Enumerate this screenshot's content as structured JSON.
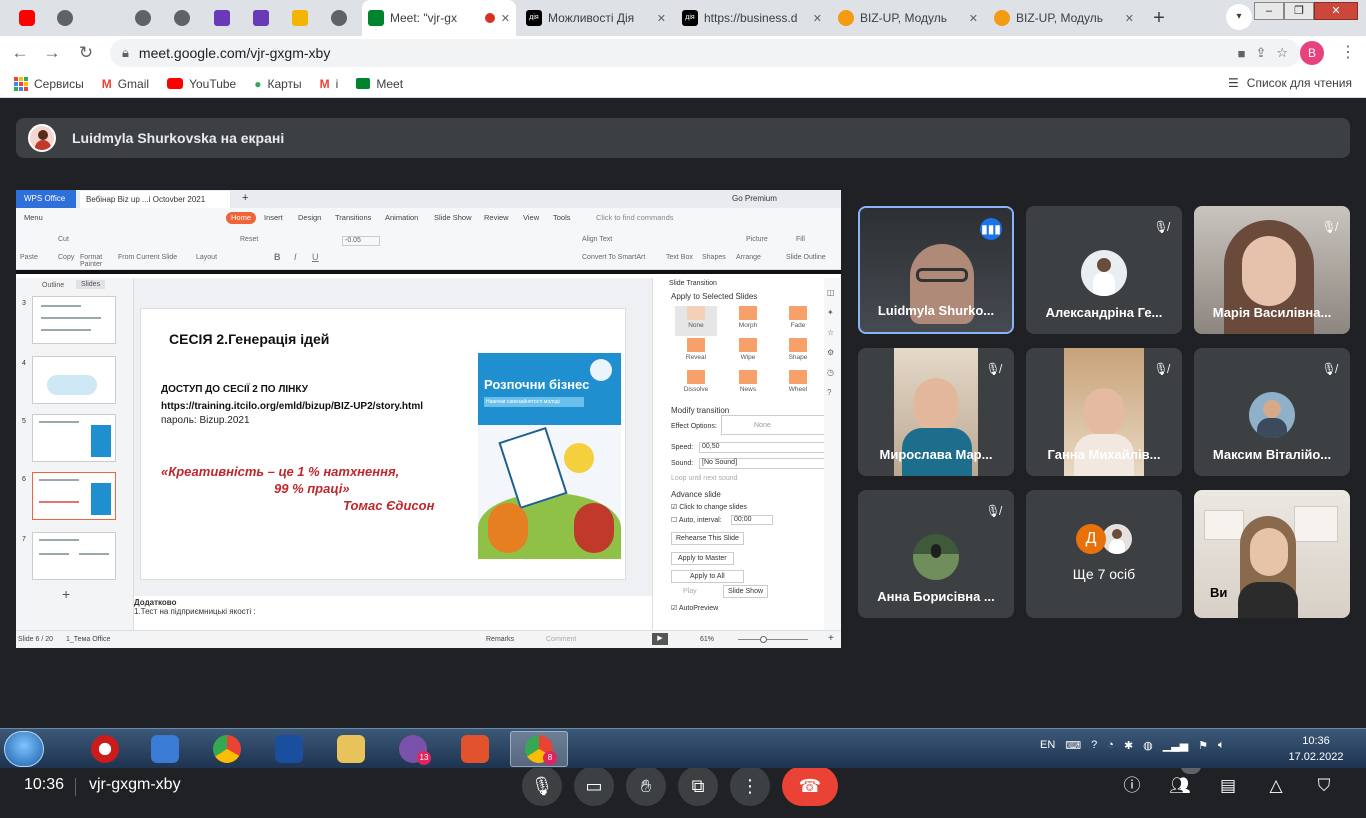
{
  "browser": {
    "tabs": [
      {
        "title": "",
        "icon": "youtube-icon",
        "color": "#ff0000"
      },
      {
        "title": "",
        "icon": "globe-icon",
        "color": "#5f6368"
      },
      {
        "title": "",
        "icon": "globe-icon",
        "color": "#5f6368"
      },
      {
        "title": "",
        "icon": "globe-icon",
        "color": "#5f6368"
      },
      {
        "title": "",
        "icon": "forms-icon",
        "color": "#673ab7"
      },
      {
        "title": "",
        "icon": "forms-icon",
        "color": "#673ab7"
      },
      {
        "title": "",
        "icon": "slides-icon",
        "color": "#f4b400"
      },
      {
        "title": "",
        "icon": "globe-icon",
        "color": "#5f6368"
      },
      {
        "title": "Meet: \"vjr-gx",
        "icon": "meet-icon",
        "color": "#00832d",
        "active": true
      },
      {
        "title": "Можливості Дія",
        "icon": "diia-icon",
        "color": "#000000"
      },
      {
        "title": "https://business.d",
        "icon": "diia-icon",
        "color": "#000000"
      },
      {
        "title": "BIZ-UP, Модуль",
        "icon": "bizup-icon",
        "color": "#f39c12"
      },
      {
        "title": "BIZ-UP, Модуль",
        "icon": "bizup-icon",
        "color": "#f39c12"
      }
    ],
    "url": "meet.google.com/vjr-gxgm-xby",
    "profile_initial": "B",
    "bookmarks": [
      {
        "label": "Сервисы",
        "icon": "apps-grid-icon"
      },
      {
        "label": "Gmail",
        "icon": "gmail-icon"
      },
      {
        "label": "YouTube",
        "icon": "youtube-icon"
      },
      {
        "label": "Карты",
        "icon": "maps-icon"
      },
      {
        "label": "i",
        "icon": "gmail-icon"
      },
      {
        "label": "Meet",
        "icon": "meet-icon"
      }
    ],
    "reading_list": "Список для чтения"
  },
  "meet": {
    "presenter_banner": "Luidmyla Shurkovska на екрані",
    "time": "10:36",
    "meeting_code": "vjr-gxgm-xby",
    "participant_count": "16",
    "participants": [
      {
        "name": "Luidmyla Shurko...",
        "mic": "speaking",
        "video": true
      },
      {
        "name": "Александріна Ге...",
        "mic": "muted",
        "video": false
      },
      {
        "name": "Марія Василівна...",
        "mic": "muted",
        "video": true
      },
      {
        "name": "Мирослава Мар...",
        "mic": "muted",
        "video": true
      },
      {
        "name": "Ганна Михайлів...",
        "mic": "muted",
        "video": true
      },
      {
        "name": "Максим Віталійо...",
        "mic": "muted",
        "video": false
      },
      {
        "name": "Анна Борисівна ...",
        "mic": "muted",
        "video": false
      },
      {
        "name": "Ще 7 осіб",
        "initial": "Д"
      },
      {
        "name": "Ви",
        "video": true
      }
    ]
  },
  "wps": {
    "app_tab": "WPS Office",
    "doc_tab": "Вебінар Biz up ...i Octovber 2021",
    "premium": "Go Premium",
    "menu": [
      "Menu",
      "Home",
      "Insert",
      "Design",
      "Transitions",
      "Animation",
      "Slide Show",
      "Review",
      "View",
      "Tools",
      "Click to find commands"
    ],
    "ribbon": [
      "Paste",
      "Cut",
      "Copy",
      "Format Painter",
      "From Current Slide",
      "Layout",
      "Reset",
      "-0.05",
      "Align Text",
      "Convert To SmartArt",
      "Text Box",
      "Shapes",
      "Picture",
      "Arrange",
      "Fill",
      "Slide Outline"
    ],
    "left_tabs": [
      "Outline",
      "Slides"
    ],
    "slide_numbers": [
      "3",
      "4",
      "5",
      "6",
      "7"
    ],
    "slide": {
      "title": "СЕСІЯ 2.Генерація ідей",
      "access_line": "ДОСТУП ДО СЕСІЇ 2 ПО ЛІНКУ",
      "link": "https://training.itcilo.org/emld/bizup/BIZ-UP2/story.html",
      "password": "пароль: Bizup.2021",
      "quote_1": "«Креативність – це 1 % натхнення,",
      "quote_2": "99 % праці»",
      "quote_3": "Томас Єдисон",
      "book_title": "Розпочни бізнес",
      "book_subtitle": "Навички самозайнятості молоді"
    },
    "notes_heading": "Додатково",
    "notes_line": "1.Тест на підприємницькі якості :",
    "transition_panel": {
      "header": "Slide Transition",
      "apply_label": "Apply to Selected Slides",
      "effects": [
        "None",
        "Morph",
        "Fade",
        "Reveal",
        "Wipe",
        "Shape",
        "Dissolve",
        "News",
        "Wheel"
      ],
      "modify": "Modify transition",
      "effect_options_label": "Effect Options:",
      "effect_options_value": "None",
      "speed_label": "Speed:",
      "speed_value": "00,50",
      "sound_label": "Sound:",
      "sound_value": "[No Sound]",
      "loop": "Loop until next sound",
      "advance": "Advance slide",
      "click_change": "Click to change slides",
      "auto_interval": "Auto, interval:",
      "interval_value": "00:00",
      "rehearse": "Rehearse This Slide",
      "apply_master": "Apply to Master",
      "apply_all": "Apply to All",
      "play": "Play",
      "slide_show": "Slide Show",
      "autopreview": "AutoPreview"
    },
    "status": {
      "slide_info": "Slide 6 / 20",
      "theme": "1_Тема Office",
      "remarks": "Remarks",
      "comment": "Comment",
      "zoom": "61%"
    }
  },
  "taskbar": {
    "apps": [
      {
        "name": "opera",
        "color": "#cc1b1b"
      },
      {
        "name": "media-player",
        "color": "#3a7bd5"
      },
      {
        "name": "chrome",
        "color": "#34a853"
      },
      {
        "name": "save",
        "color": "#1a4fa0"
      },
      {
        "name": "explorer",
        "color": "#e8c25a"
      },
      {
        "name": "viber",
        "color": "#7b52ab",
        "badge": "13"
      },
      {
        "name": "wps-presentation",
        "color": "#e2532d"
      },
      {
        "name": "chrome-active",
        "color": "#ea4335",
        "badge": "8",
        "active": true
      }
    ],
    "language": "EN",
    "time": "10:36",
    "date": "17.02.2022"
  }
}
